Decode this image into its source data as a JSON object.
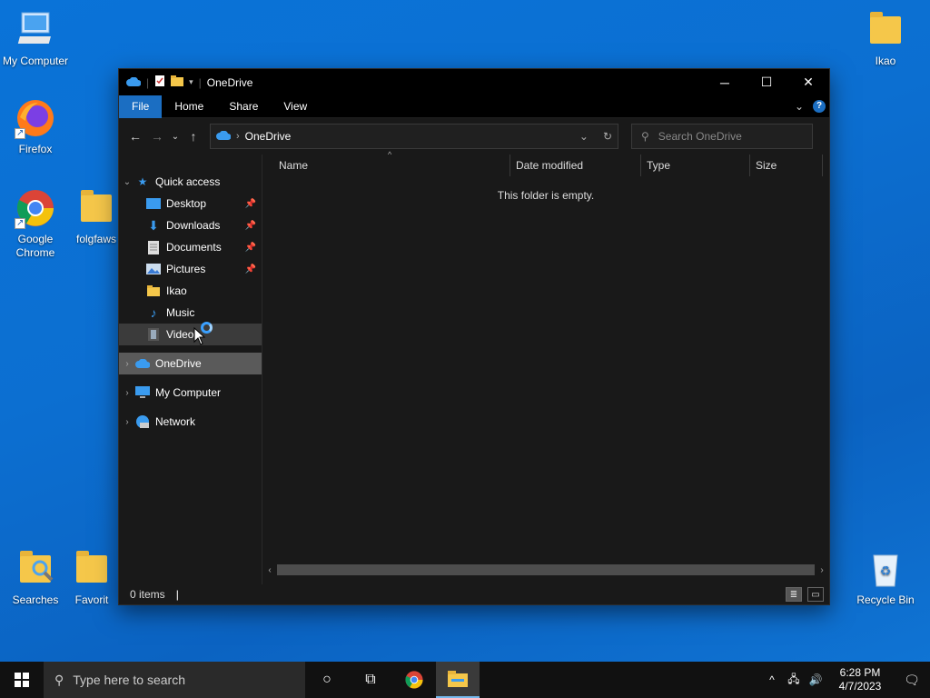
{
  "desktop": {
    "icons": [
      {
        "label": "My Computer"
      },
      {
        "label": "Firefox"
      },
      {
        "label": "Google Chrome"
      },
      {
        "label": "folgfaws"
      },
      {
        "label": "Searches"
      },
      {
        "label": "Favorit"
      },
      {
        "label": "Ikao"
      },
      {
        "label": "Recycle Bin"
      }
    ]
  },
  "window": {
    "title": "OneDrive",
    "ribbon_tabs": [
      "File",
      "Home",
      "Share",
      "View"
    ],
    "help_label": "?",
    "address": {
      "location": "OneDrive"
    },
    "search": {
      "placeholder": "Search OneDrive"
    },
    "nav_pane": {
      "quick_access": "Quick access",
      "quick_items": [
        {
          "label": "Desktop",
          "pinned": true
        },
        {
          "label": "Downloads",
          "pinned": true
        },
        {
          "label": "Documents",
          "pinned": true
        },
        {
          "label": "Pictures",
          "pinned": true
        },
        {
          "label": "Ikao",
          "pinned": false
        },
        {
          "label": "Music",
          "pinned": false
        },
        {
          "label": "Videos",
          "pinned": false
        }
      ],
      "onedrive": "OneDrive",
      "my_computer": "My Computer",
      "network": "Network"
    },
    "columns": [
      "Name",
      "Date modified",
      "Type",
      "Size"
    ],
    "empty_message": "This folder is empty.",
    "status": {
      "items": "0 items"
    }
  },
  "taskbar": {
    "search_placeholder": "Type here to search",
    "time": "6:28 PM",
    "date": "4/7/2023"
  },
  "colors": {
    "accent": "#1b6ec2",
    "desktop_bg": "#0a73d8"
  }
}
